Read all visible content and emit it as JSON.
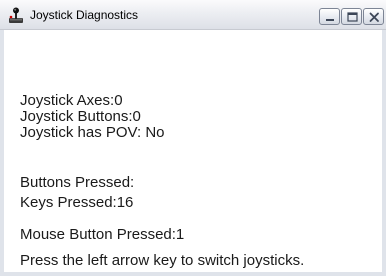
{
  "window": {
    "title": "Joystick Diagnostics",
    "controls": {
      "minimize_icon": "minimize-icon",
      "maximize_icon": "maximize-icon",
      "close_icon": "close-icon"
    },
    "app_icon": "joystick-icon"
  },
  "info": {
    "axes": "Joystick Axes:0",
    "buttons": "Joystick Buttons:0",
    "pov": "Joystick has POV: No",
    "buttons_pressed": "Buttons Pressed:",
    "keys_pressed": "Keys Pressed:16",
    "mouse_pressed": "Mouse Button Pressed:1",
    "instruction": "Press the left arrow key to switch joysticks."
  }
}
